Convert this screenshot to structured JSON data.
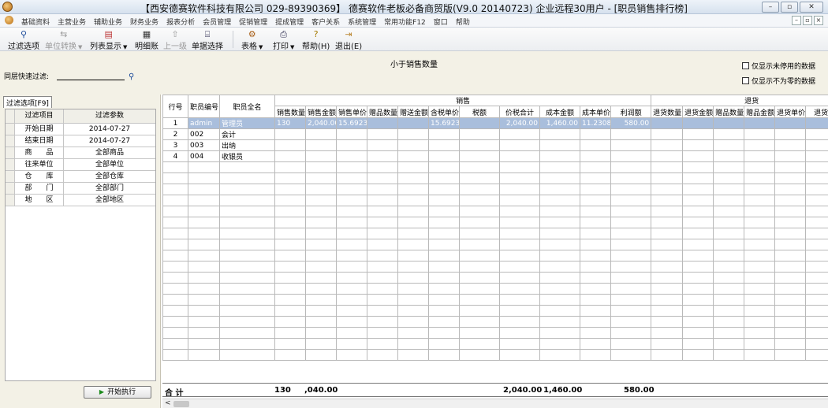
{
  "window": {
    "title": "【西安德赛软件科技有限公司 029-89390369】 德赛软件老板必备商贸版(V9.0 20140723) 企业远程30用户 - [职员销售排行榜]",
    "minimize": "–",
    "maximize": "▫",
    "close": "✕"
  },
  "menu": {
    "items": [
      "基础资料",
      "主营业务",
      "辅助业务",
      "财务业务",
      "报表分析",
      "会员管理",
      "促销管理",
      "提成管理",
      "客户关系",
      "系统管理",
      "常用功能F12",
      "窗口",
      "帮助"
    ]
  },
  "toolbar": {
    "filter": "过滤选项",
    "unit": "单位转换",
    "list": "列表显示",
    "detail": "明细账",
    "up": "上一级",
    "doc": "单据选择",
    "table": "表格",
    "print": "打印",
    "help": "帮助(H)",
    "exit": "退出(E)"
  },
  "topbar": {
    "center_title": "小于销售数量",
    "quick_filter_label": "同层快速过滤:",
    "chk_unused": "仅显示未停用的数据",
    "chk_nonzero": "仅显示不为零的数据"
  },
  "left": {
    "tab": "过滤选项[F9]",
    "head_item": "过滤项目",
    "head_param": "过滤参数",
    "rows": [
      {
        "item": "开始日期",
        "param": "2014-07-27"
      },
      {
        "item": "结束日期",
        "param": "2014-07-27"
      },
      {
        "item": "商　　品",
        "param": "全部商品"
      },
      {
        "item": "往来单位",
        "param": "全部单位"
      },
      {
        "item": "仓　　库",
        "param": "全部仓库"
      },
      {
        "item": "部　　门",
        "param": "全部部门"
      },
      {
        "item": "地　　区",
        "param": "全部地区"
      }
    ],
    "exec_button": "开始执行"
  },
  "grid": {
    "col_rowno": "行号",
    "col_empno": "职员编号",
    "col_empname": "职员全名",
    "group_sales": "销售",
    "group_return": "退货",
    "sales_cols": [
      "销售数量",
      "销售金额",
      "销售单价",
      "赠品数量",
      "赠送金额",
      "含税单价",
      "税额",
      "价税合计",
      "成本金额",
      "成本单价",
      "利润额"
    ],
    "return_cols": [
      "退货数量",
      "退货金额",
      "赠品数量",
      "赠品金额",
      "退货单价",
      "退货"
    ],
    "rows": [
      {
        "no": "1",
        "code": "admin",
        "name": "管理员",
        "v": [
          "130",
          "2,040.00",
          "15.6923",
          "",
          "",
          "15.6923",
          "",
          "2,040.00",
          "1,460.00",
          "11.2308",
          "580.00"
        ]
      },
      {
        "no": "2",
        "code": "002",
        "name": "会计",
        "v": [
          "",
          "",
          "",
          "",
          "",
          "",
          "",
          "",
          "",
          "",
          ""
        ]
      },
      {
        "no": "3",
        "code": "003",
        "name": "出纳",
        "v": [
          "",
          "",
          "",
          "",
          "",
          "",
          "",
          "",
          "",
          "",
          ""
        ]
      },
      {
        "no": "4",
        "code": "004",
        "name": "收银员",
        "v": [
          "",
          "",
          "",
          "",
          "",
          "",
          "",
          "",
          "",
          "",
          ""
        ]
      }
    ],
    "total_label": "合 计",
    "total_qty": "130",
    "total_amount": ",040.00",
    "total_taxsum": "2,040.00",
    "total_cost": "1,460.00",
    "total_profit": "580.00"
  }
}
